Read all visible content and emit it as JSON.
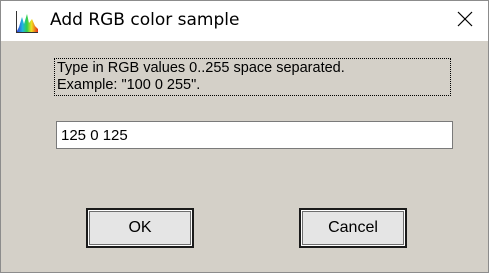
{
  "window": {
    "title": "Add RGB color sample",
    "icon": "spectrum-icon",
    "close_icon": "close-icon"
  },
  "dialog": {
    "instructions_line1": "Type in RGB values 0..255 space separated.",
    "instructions_line2": "Example: \"100 0 255\".",
    "rgb_value": "125 0 125",
    "ok_label": "OK",
    "cancel_label": "Cancel"
  },
  "colors": {
    "dialog_background": "#d4d0c8",
    "titlebar_background": "#ffffff",
    "input_background": "#ffffff"
  }
}
